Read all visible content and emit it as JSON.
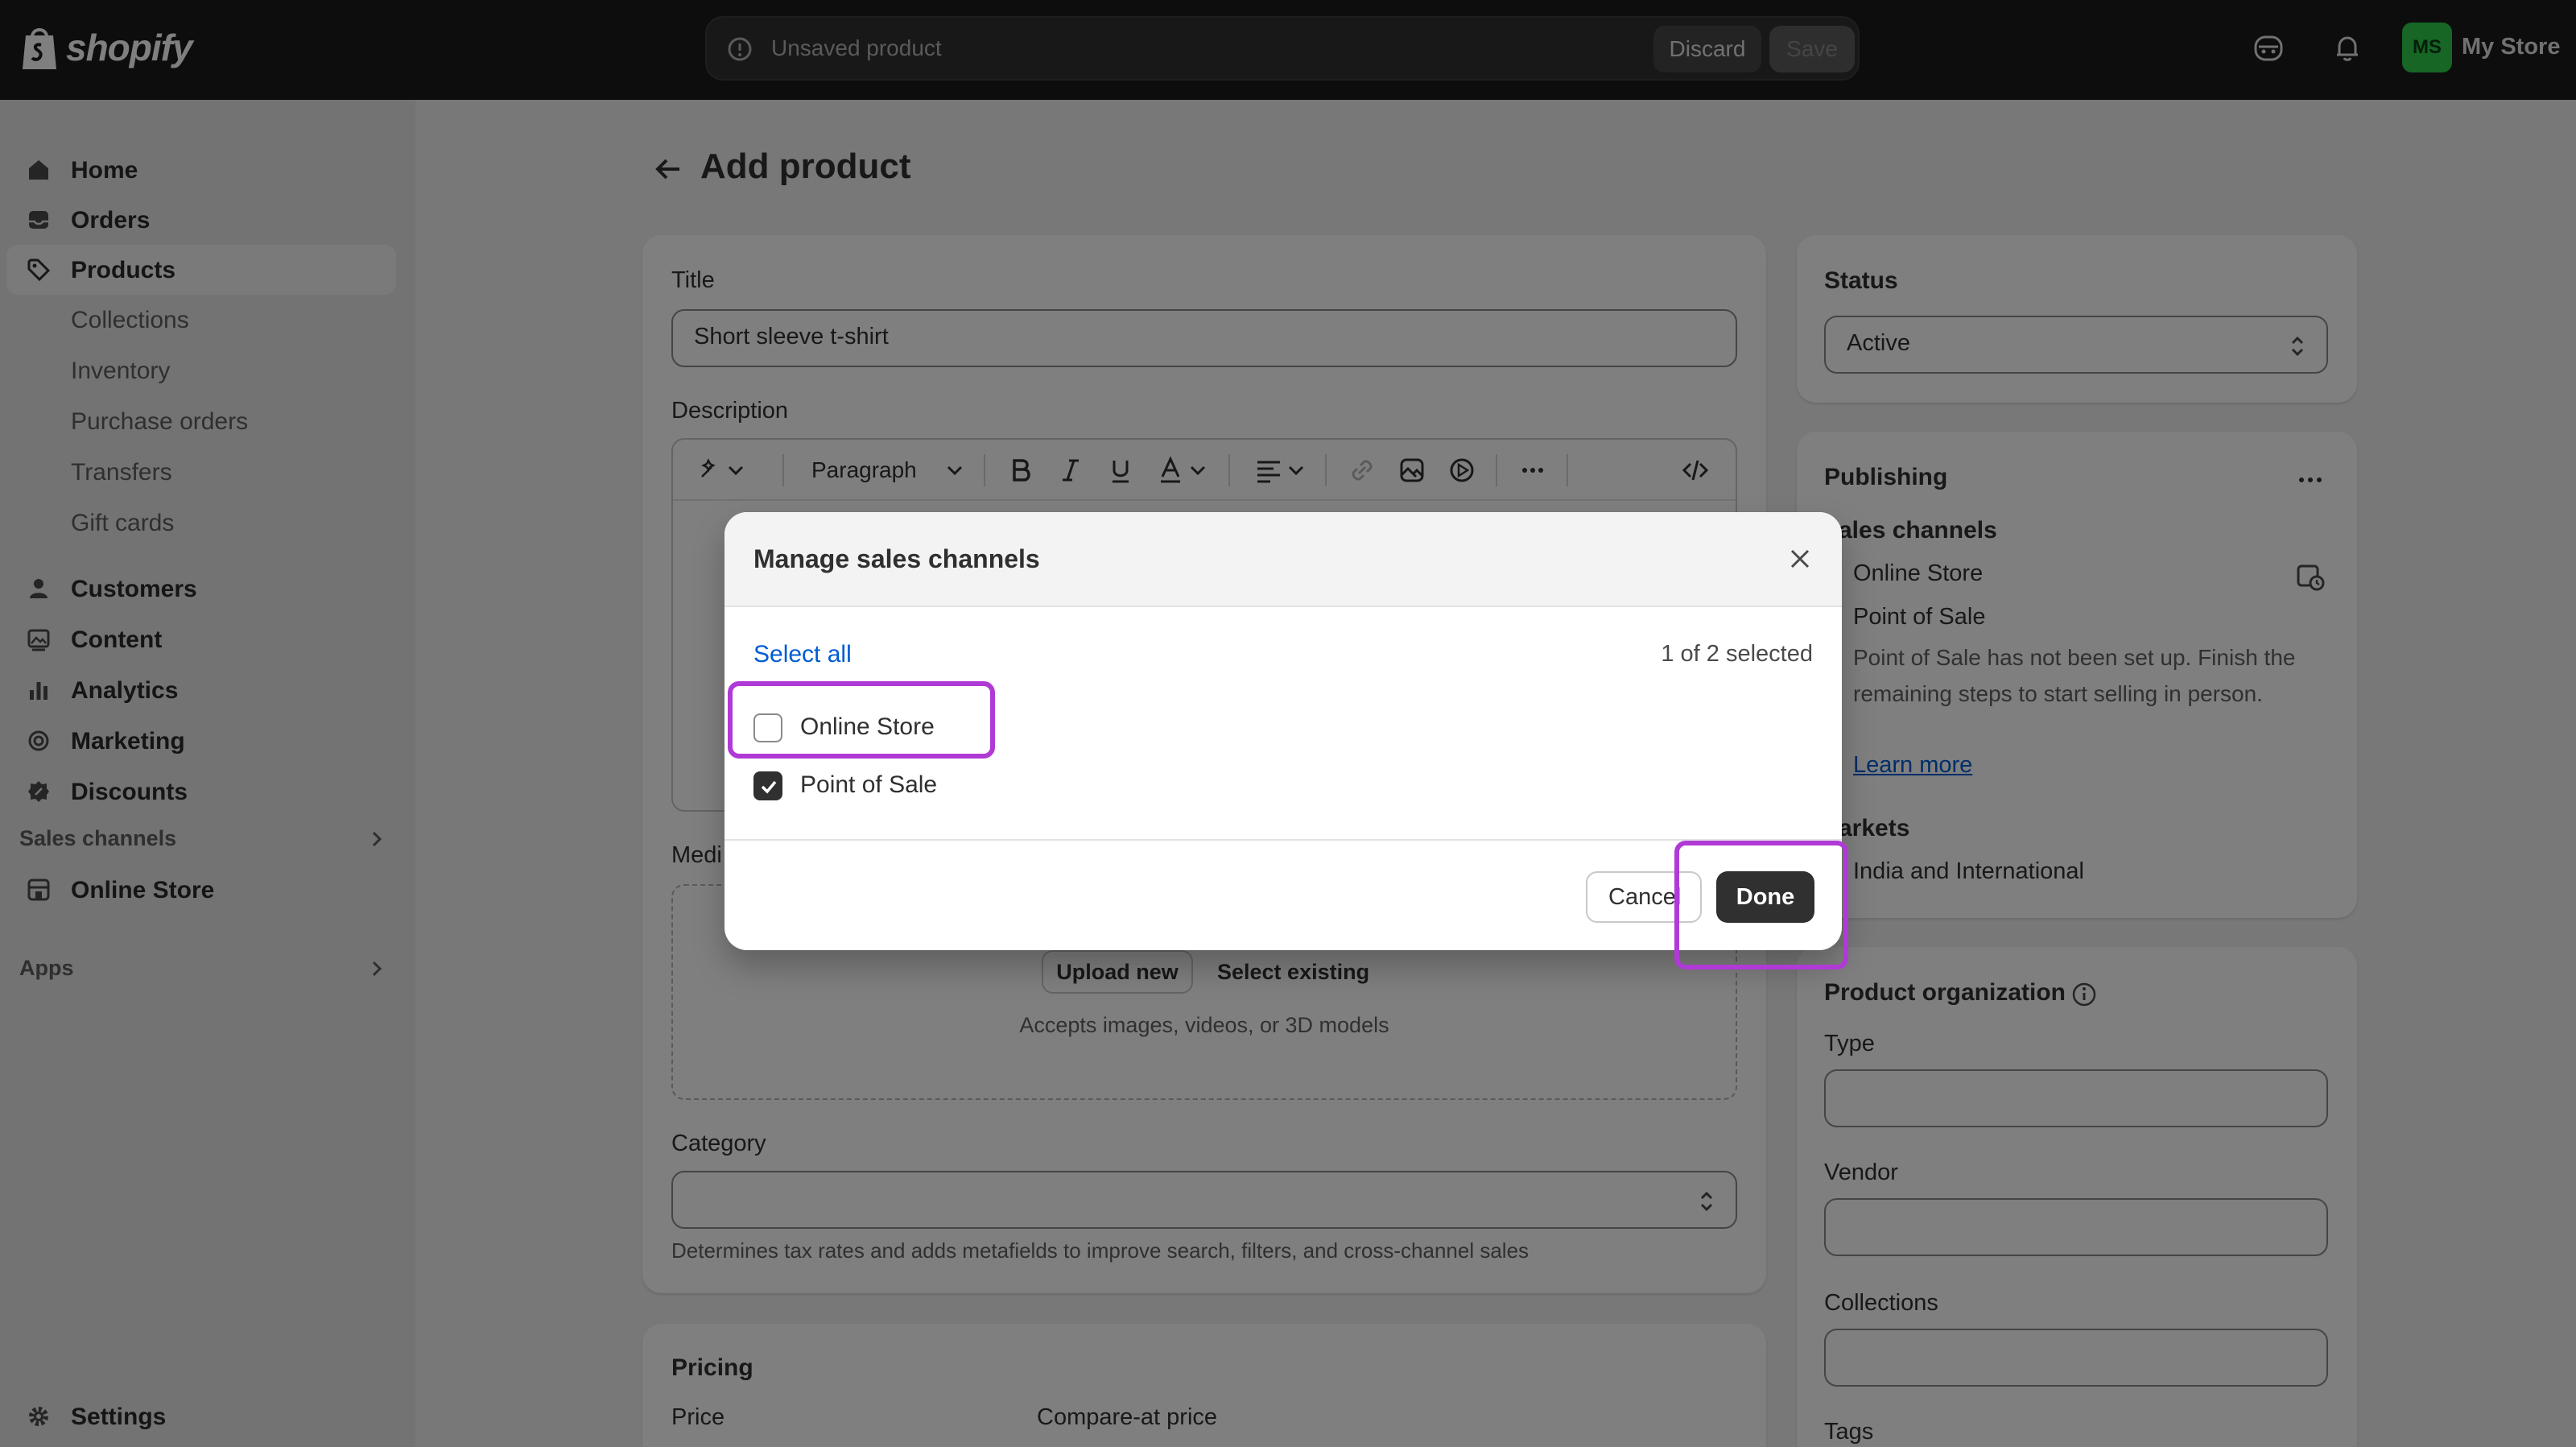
{
  "brand": {
    "logo_text": "shopify"
  },
  "topbar": {
    "unsaved_text": "Unsaved product",
    "discard_label": "Discard",
    "save_label": "Save",
    "avatar_initials": "MS",
    "store_name": "My Store"
  },
  "sidebar": {
    "items": [
      {
        "label": "Home",
        "icon": "home-icon"
      },
      {
        "label": "Orders",
        "icon": "inbox-icon"
      },
      {
        "label": "Products",
        "icon": "tag-icon",
        "active": true
      },
      {
        "label": "Collections"
      },
      {
        "label": "Inventory"
      },
      {
        "label": "Purchase orders"
      },
      {
        "label": "Transfers"
      },
      {
        "label": "Gift cards"
      },
      {
        "label": "Customers",
        "icon": "person-icon"
      },
      {
        "label": "Content",
        "icon": "content-icon"
      },
      {
        "label": "Analytics",
        "icon": "bar-chart-icon"
      },
      {
        "label": "Marketing",
        "icon": "target-icon"
      },
      {
        "label": "Discounts",
        "icon": "discount-icon"
      }
    ],
    "sales_channels_label": "Sales channels",
    "online_store_label": "Online Store",
    "apps_label": "Apps",
    "settings_label": "Settings"
  },
  "page": {
    "title": "Add product",
    "title_label": "Title",
    "title_value": "Short sleeve t-shirt",
    "description_label": "Description",
    "paragraph_label": "Paragraph",
    "media_label": "Medi",
    "upload_new_label": "Upload new",
    "select_existing_label": "Select existing",
    "media_hint": "Accepts images, videos, or 3D models",
    "category_label": "Category",
    "category_hint": "Determines tax rates and adds metafields to improve search, filters, and cross-channel sales",
    "pricing_label": "Pricing",
    "price_label": "Price",
    "compare_price_label": "Compare-at price"
  },
  "right": {
    "status_label": "Status",
    "status_value": "Active",
    "publishing_label": "Publishing",
    "sales_channels_label": "ales channels",
    "channel_online_store": "Online Store",
    "channel_pos": "Point of Sale",
    "pos_note": "Point of Sale has not been set up. Finish the remaining steps to start selling in person.",
    "learn_more": "Learn more",
    "markets_label": "arkets",
    "markets_value": "India and International",
    "org_label": "Product organization",
    "type_label": "Type",
    "vendor_label": "Vendor",
    "collections_label": "Collections",
    "tags_label": "Tags"
  },
  "modal": {
    "title": "Manage sales channels",
    "select_all": "Select all",
    "selected_count": "1 of 2 selected",
    "options": [
      {
        "label": "Online Store",
        "checked": false
      },
      {
        "label": "Point of Sale",
        "checked": true
      }
    ],
    "cancel_label": "Cancel",
    "done_label": "Done"
  },
  "colors": {
    "highlight": "#b03ad6",
    "link": "#005bd3",
    "avatar": "#2ecc4a"
  }
}
